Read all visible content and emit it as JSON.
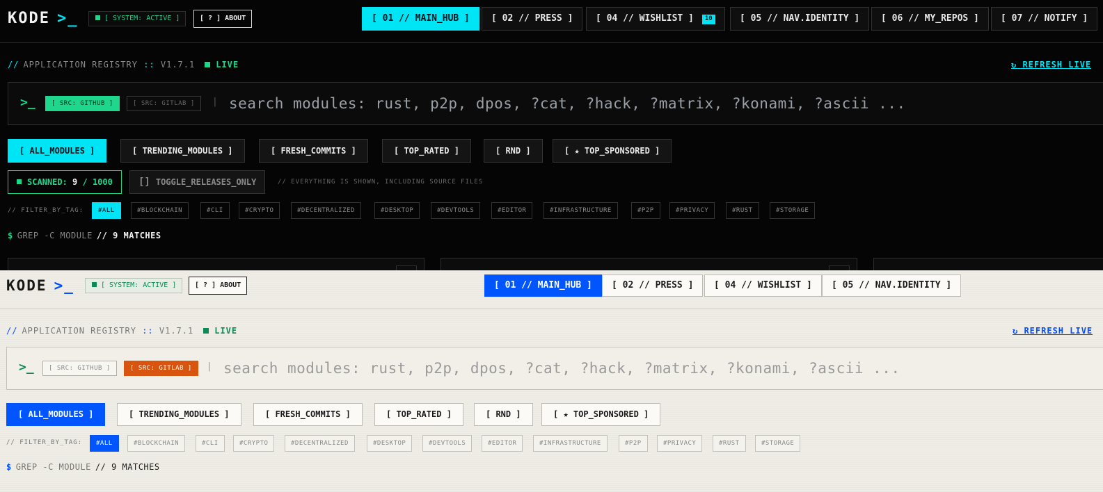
{
  "app": {
    "logo": "KODE",
    "prompt": ">_",
    "system_status": "[ SYSTEM: ACTIVE ]",
    "about": "[ ? ] ABOUT"
  },
  "nav": {
    "main_hub": "[ 01 // MAIN_HUB ]",
    "press": "[ 02 // PRESS ]",
    "wishlist": "[ 04 // WISHLIST ]",
    "wishlist_count": "10",
    "nav_identity": "[ 05 // NAV.IDENTITY ]",
    "my_repos": "[ 06 // MY_REPOS ]",
    "notify": "[ 07 // NOTIFY ]"
  },
  "registry": {
    "slash": "//",
    "label": "APPLICATION REGISTRY",
    "sep": "::",
    "version": "V1.7.1",
    "live": "LIVE",
    "refresh": "↻ REFRESH LIVE"
  },
  "search": {
    "prompt": ">_",
    "src_github": "[ SRC: GITHUB ]",
    "src_gitlab": "[ SRC: GITLAB ]",
    "pipe": "|",
    "placeholder": "search modules: rust, p2p, dpos, ?cat, ?hack, ?matrix, ?konami, ?ascii ..."
  },
  "filters": {
    "all_modules": "[ ALL_MODULES ]",
    "trending": "[ TRENDING_MODULES ]",
    "fresh": "[ FRESH_COMMITS ]",
    "top_rated": "[ TOP_RATED ]",
    "rnd": "[ RND ]",
    "top_sponsored": "[ ★ TOP_SPONSORED ]"
  },
  "scan": {
    "label": "SCANNED:",
    "count": "9",
    "total": "/ 1000",
    "toggle_box": "[]",
    "toggle_label": "TOGGLE_RELEASES_ONLY",
    "hint": "// EVERYTHING IS SHOWN, INCLUDING SOURCE FILES"
  },
  "tags": {
    "label": "// FILTER_BY_TAG:",
    "all": "#ALL",
    "blockchain": "#BLOCKCHAIN",
    "cli": "#CLI",
    "crypto": "#CRYPTO",
    "decentralized": "#DECENTRALIZED",
    "desktop": "#DESKTOP",
    "devtools": "#DEVTOOLS",
    "editor": "#EDITOR",
    "infrastructure": "#INFRASTRUCTURE",
    "p2p": "#P2P",
    "privacy": "#PRIVACY",
    "rust": "#RUST",
    "storage": "#STORAGE"
  },
  "grep": {
    "dollar": "$",
    "command": "GREP -C MODULE",
    "matches": "// 9 MATCHES"
  },
  "colors": {
    "dark_accent": "#00e5f5",
    "dark_green": "#1fd68d",
    "light_accent": "#0055ff",
    "light_gitlab": "#d7550f",
    "light_green": "#0d8a55"
  }
}
